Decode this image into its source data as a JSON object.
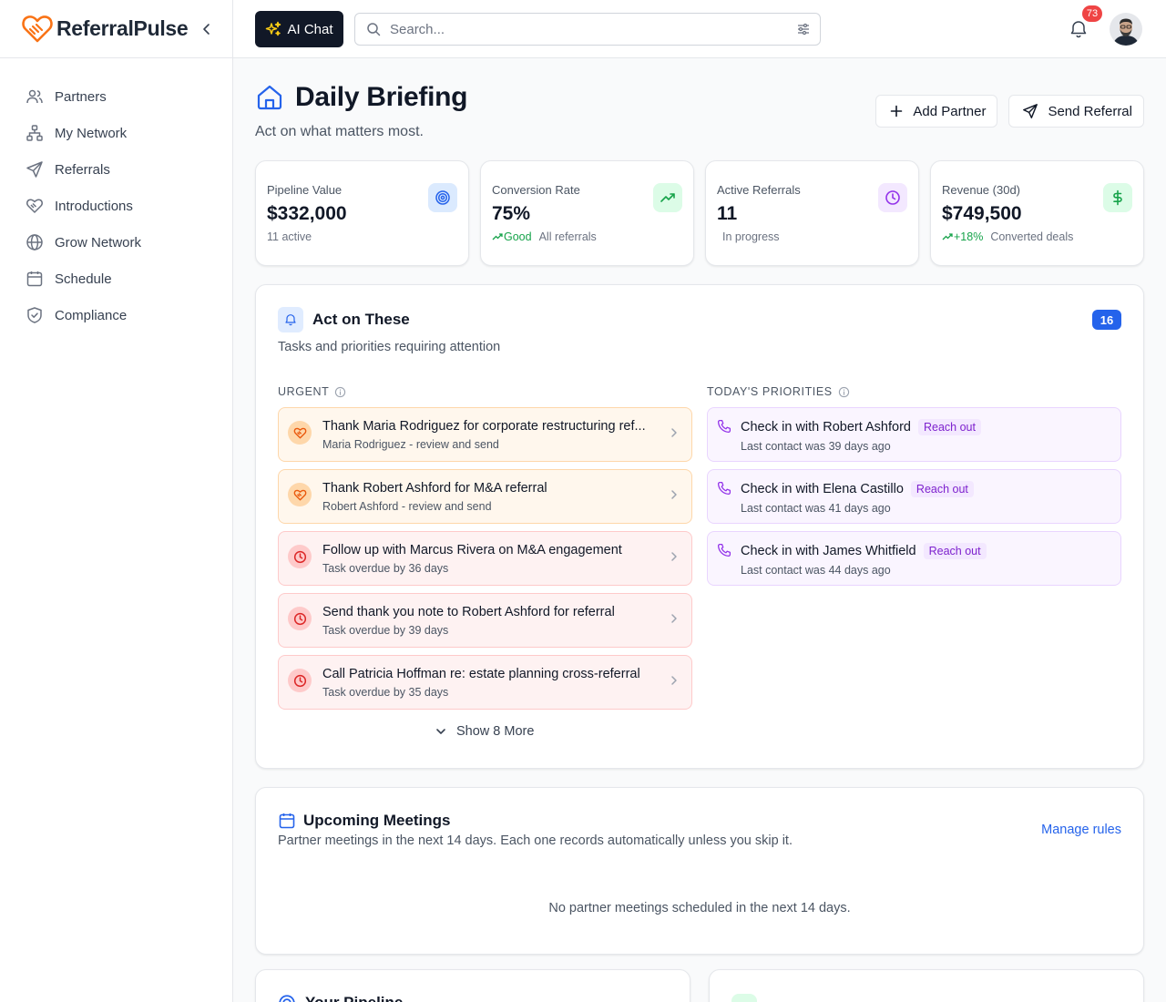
{
  "app": {
    "name": "ReferralPulse"
  },
  "sidebar": {
    "items": [
      {
        "label": "Partners",
        "icon": "users-icon"
      },
      {
        "label": "My Network",
        "icon": "network-icon"
      },
      {
        "label": "Referrals",
        "icon": "send-icon"
      },
      {
        "label": "Introductions",
        "icon": "handshake-icon"
      },
      {
        "label": "Grow Network",
        "icon": "globe-icon"
      },
      {
        "label": "Schedule",
        "icon": "calendar-icon"
      },
      {
        "label": "Compliance",
        "icon": "shield-icon"
      }
    ]
  },
  "topbar": {
    "ai_chat_label": "AI Chat",
    "search_placeholder": "Search...",
    "notification_count": "73"
  },
  "page": {
    "title": "Daily Briefing",
    "subtitle": "Act on what matters most.",
    "add_partner_label": "Add Partner",
    "send_referral_label": "Send Referral"
  },
  "stats": [
    {
      "label": "Pipeline Value",
      "value": "$332,000",
      "sub": "11 active",
      "accent": "#3b82f6"
    },
    {
      "label": "Conversion Rate",
      "value": "75%",
      "trend": "Good",
      "sub": "All referrals",
      "accent": "#16a34a"
    },
    {
      "label": "Active Referrals",
      "value": "11",
      "sub": "In progress",
      "accent": "#a855f7"
    },
    {
      "label": "Revenue (30d)",
      "value": "$749,500",
      "trend": "+18%",
      "sub": "Converted deals",
      "accent": "#16a34a"
    }
  ],
  "act": {
    "title": "Act on These",
    "description": "Tasks and priorities requiring attention",
    "count": "16",
    "urgent_heading": "URGENT",
    "priorities_heading": "TODAY'S PRIORITIES",
    "urgent": [
      {
        "title": "Thank Maria Rodriguez for corporate restructuring ref...",
        "sub": "Maria Rodriguez - review and send",
        "kind": "thank"
      },
      {
        "title": "Thank Robert Ashford for M&A referral",
        "sub": "Robert Ashford - review and send",
        "kind": "thank"
      },
      {
        "title": "Follow up with Marcus Rivera on M&A engagement",
        "sub": "Task overdue by 36 days",
        "kind": "overdue"
      },
      {
        "title": "Send thank you note to Robert Ashford for referral",
        "sub": "Task overdue by 39 days",
        "kind": "overdue"
      },
      {
        "title": "Call Patricia Hoffman re: estate planning cross-referral",
        "sub": "Task overdue by 35 days",
        "kind": "overdue"
      }
    ],
    "priorities": [
      {
        "title": "Check in with Robert Ashford",
        "tag": "Reach out",
        "sub": "Last contact was 39 days ago"
      },
      {
        "title": "Check in with Elena Castillo",
        "tag": "Reach out",
        "sub": "Last contact was 41 days ago"
      },
      {
        "title": "Check in with James Whitfield",
        "tag": "Reach out",
        "sub": "Last contact was 44 days ago"
      }
    ],
    "show_more_label": "Show 8 More"
  },
  "meetings": {
    "title": "Upcoming Meetings",
    "description": "Partner meetings in the next 14 days. Each one records automatically unless you skip it.",
    "manage_label": "Manage rules",
    "empty_text": "No partner meetings scheduled in the next 14 days."
  },
  "bottom": {
    "left_title": "Your Pipeline"
  }
}
